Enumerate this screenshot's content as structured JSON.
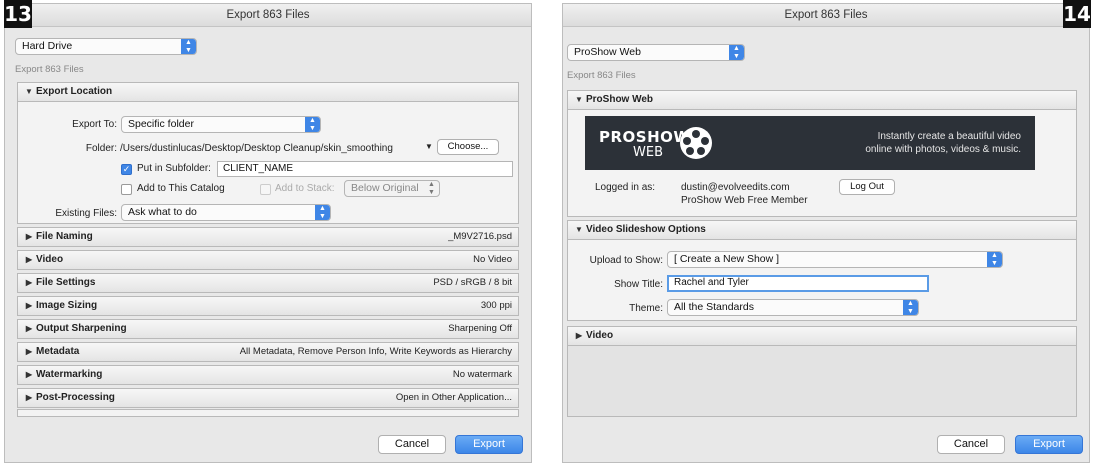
{
  "left": {
    "badge": "13",
    "title": "Export 863 Files",
    "preset": "Hard Drive",
    "subtitle": "Export 863 Files",
    "export_location": {
      "header": "Export Location",
      "export_to_label": "Export To:",
      "export_to_value": "Specific folder",
      "folder_label": "Folder:",
      "folder_path": "/Users/dustinlucas/Desktop/Desktop Cleanup/skin_smoothing",
      "choose_label": "Choose...",
      "subfolder_label": "Put in Subfolder:",
      "subfolder_value": "CLIENT_NAME",
      "catalog_label": "Add to This Catalog",
      "stack_label": "Add to Stack:",
      "stack_value": "Below Original",
      "existing_label": "Existing Files:",
      "existing_value": "Ask what to do"
    },
    "sections": [
      {
        "name": "File Naming",
        "value": "_M9V2716.psd"
      },
      {
        "name": "Video",
        "value": "No Video"
      },
      {
        "name": "File Settings",
        "value": "PSD / sRGB / 8 bit"
      },
      {
        "name": "Image Sizing",
        "value": "300 ppi"
      },
      {
        "name": "Output Sharpening",
        "value": "Sharpening Off"
      },
      {
        "name": "Metadata",
        "value": "All Metadata, Remove Person Info, Write Keywords as Hierarchy"
      },
      {
        "name": "Watermarking",
        "value": "No watermark"
      },
      {
        "name": "Post-Processing",
        "value": "Open in Other Application..."
      }
    ],
    "cancel": "Cancel",
    "export": "Export"
  },
  "right": {
    "badge": "14",
    "title": "Export 863 Files",
    "preset": "ProShow Web",
    "subtitle": "Export 863 Files",
    "proshow": {
      "header": "ProShow Web",
      "logo_main": "PROSHOW",
      "logo_sub": "WEB",
      "tagline1": "Instantly create a beautiful video",
      "tagline2": "online with photos, videos & music.",
      "logged_label": "Logged in as:",
      "email": "dustin@evolveedits.com",
      "member": "ProShow Web Free Member",
      "logout": "Log Out"
    },
    "slideshow": {
      "header": "Video Slideshow Options",
      "upload_label": "Upload to Show:",
      "upload_value": "[ Create a New Show ]",
      "title_label": "Show Title:",
      "title_value": "Rachel and Tyler",
      "theme_label": "Theme:",
      "theme_value": "All the Standards"
    },
    "video_header": "Video",
    "cancel": "Cancel",
    "export": "Export"
  }
}
